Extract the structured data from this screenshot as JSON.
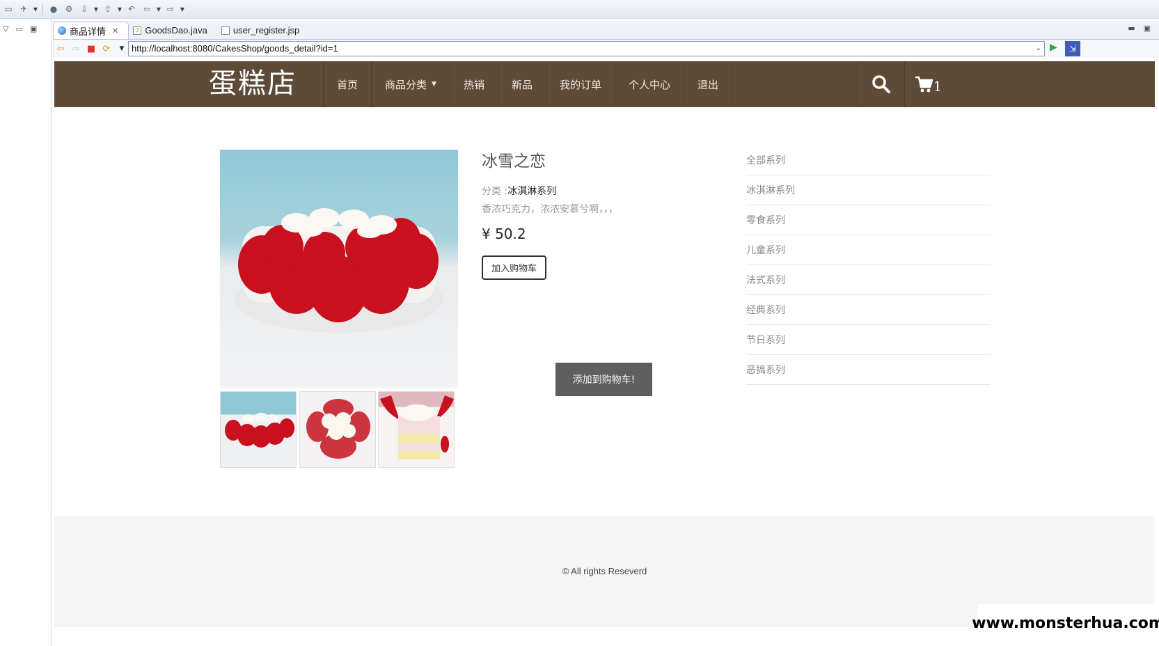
{
  "ide": {
    "toolbar_icons": [
      "new-folder-icon",
      "rocket-icon",
      "globe-icon",
      "search-refs-icon",
      "annotation-icon",
      "back-icon",
      "forward-icon"
    ],
    "tabs": [
      {
        "label": "商品详情",
        "icon": "globe-icon",
        "active": true
      },
      {
        "label": "GoodsDao.java",
        "icon": "java-file-icon",
        "active": false
      },
      {
        "label": "user_register.jsp",
        "icon": "jsp-file-icon",
        "active": false
      }
    ]
  },
  "browser": {
    "url": "http://localhost:8080/CakesShop/goods_detail?id=1"
  },
  "site": {
    "logo": "蛋糕店",
    "menu": [
      {
        "label": "首页"
      },
      {
        "label": "商品分类",
        "has_caret": true
      },
      {
        "label": "热销"
      },
      {
        "label": "新品"
      },
      {
        "label": "我的订单"
      },
      {
        "label": "个人中心"
      },
      {
        "label": "退出"
      }
    ],
    "cart_count": "1"
  },
  "product": {
    "title": "冰雪之恋",
    "category_label": "分类 :",
    "category_value": "冰淇淋系列",
    "description": "香浓巧克力，浓浓安慕兮啊，，，",
    "price": "¥ 50.2",
    "add_to_cart": "加入购物车",
    "toast": "添加到购物车!"
  },
  "categories": [
    "全部系列",
    "冰淇淋系列",
    "零食系列",
    "儿童系列",
    "法式系列",
    "经典系列",
    "节日系列",
    "恶搞系列"
  ],
  "footer": {
    "copyright": "© All rights Reseverd"
  },
  "watermark": "www.monsterhua.com",
  "colors": {
    "header_bg": "#5e4b37",
    "toast_bg": "#5f5f5f"
  }
}
